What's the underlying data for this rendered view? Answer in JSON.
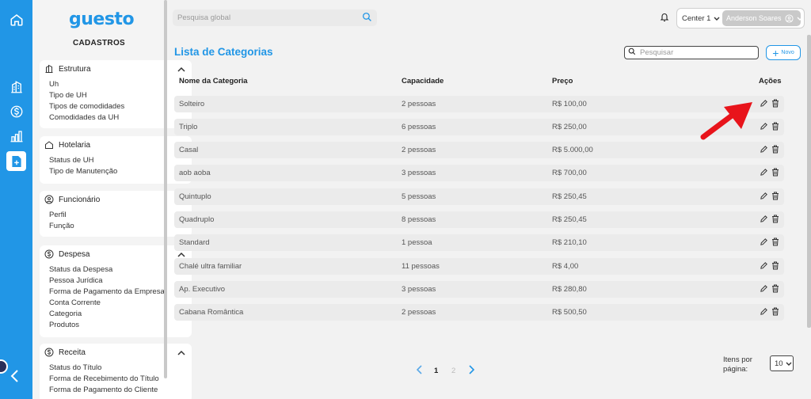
{
  "brand": {
    "logo_text": "guesto",
    "section": "CADASTROS"
  },
  "rail": {
    "icons": [
      "home-icon",
      "building-icon",
      "dollar-icon",
      "bar-chart-icon",
      "document-add-icon",
      "chevron-left-icon"
    ],
    "active": "document-add-icon"
  },
  "sidebar": {
    "groups": [
      {
        "title": "Estrutura",
        "icon": "building-icon",
        "items": [
          "Uh",
          "Tipo de UH",
          "Tipos de comodidades",
          "Comodidades da UH"
        ]
      },
      {
        "title": "Hotelaria",
        "icon": "home-icon",
        "items": [
          "Status de UH",
          "Tipo de Manutenção"
        ]
      },
      {
        "title": "Funcionário",
        "icon": "user-circle-icon",
        "items": [
          "Perfil",
          "Função"
        ]
      },
      {
        "title": "Despesa",
        "icon": "dollar-icon",
        "items": [
          "Status da Despesa",
          "Pessoa Jurídica",
          "Forma de Pagamento da Empresa",
          "Conta Corrente",
          "Categoria",
          "Produtos"
        ]
      },
      {
        "title": "Receita",
        "icon": "dollar-icon",
        "items": [
          "Status do Título",
          "Forma de Recebimento do Título",
          "Forma de Pagamento do Cliente"
        ]
      }
    ]
  },
  "topbar": {
    "search_placeholder": "Pesquisa global",
    "center": "Center 1",
    "user": "Anderson Soares"
  },
  "main": {
    "title": "Lista de Categorias",
    "search_placeholder": "Pesquisar",
    "new_label": "Novo",
    "columns": [
      "Nome da Categoria",
      "Capacidade",
      "Preço",
      "Ações"
    ],
    "rows": [
      {
        "name": "Solteiro",
        "capacity": "2 pessoas",
        "price": "R$ 100,00"
      },
      {
        "name": "Triplo",
        "capacity": "6 pessoas",
        "price": "R$ 250,00"
      },
      {
        "name": "Casal",
        "capacity": "2 pessoas",
        "price": "R$ 5.000,00"
      },
      {
        "name": "aob aoba",
        "capacity": "3 pessoas",
        "price": "R$ 700,00"
      },
      {
        "name": "Quintuplo",
        "capacity": "5 pessoas",
        "price": "R$ 250,45"
      },
      {
        "name": "Quadruplo",
        "capacity": "8 pessoas",
        "price": "R$ 250,45"
      },
      {
        "name": "Standard",
        "capacity": "1 pessoa",
        "price": "R$ 210,10"
      },
      {
        "name": "Chalé ultra familiar",
        "capacity": "11 pessoas",
        "price": "R$ 4,00"
      },
      {
        "name": "Ap. Executivo",
        "capacity": "3 pessoas",
        "price": "R$ 280,80"
      },
      {
        "name": "Cabana Romântica",
        "capacity": "2 pessoas",
        "price": "R$ 500,50"
      }
    ],
    "pagination": {
      "pages": [
        "1",
        "2"
      ],
      "current": "1",
      "per_page_label": "Itens por página:",
      "per_page": "10"
    }
  },
  "colors": {
    "accent": "#2196e6",
    "arrow": "#e8141b"
  }
}
